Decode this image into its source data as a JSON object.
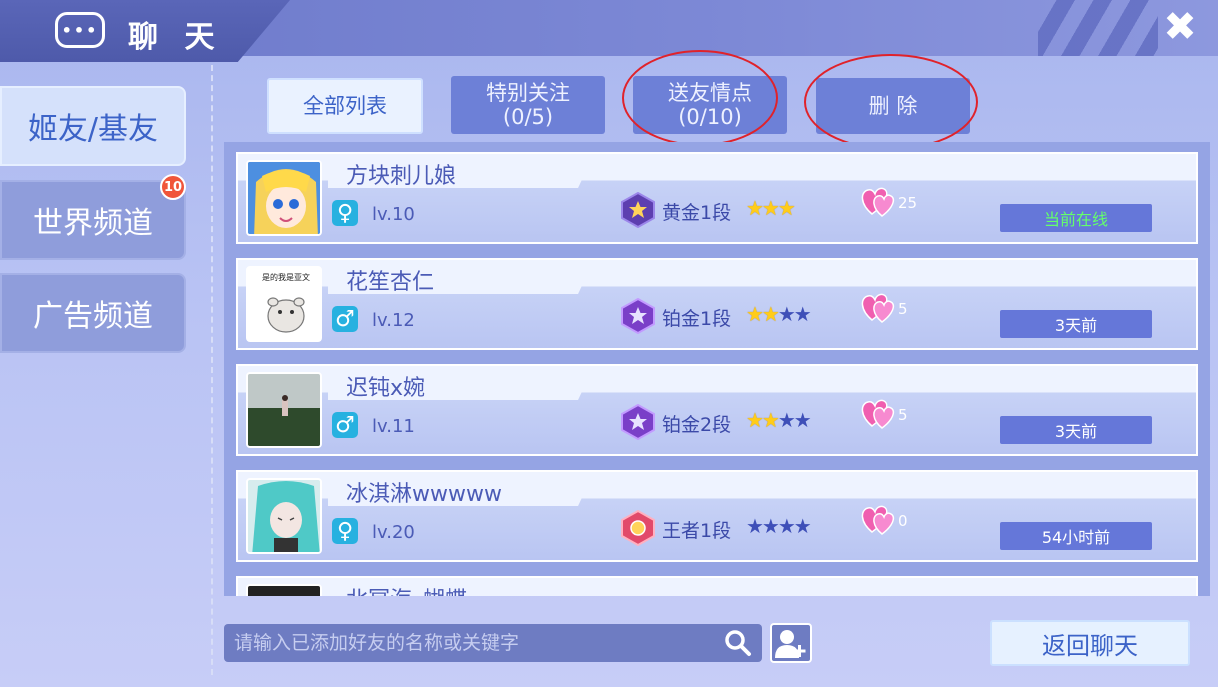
{
  "header": {
    "icon": "chat-bubble-icon",
    "icon_glyph": "•••",
    "title": "聊 天",
    "close_glyph": "✖"
  },
  "sidebar": {
    "items": [
      {
        "label": "姬友/基友",
        "active": true
      },
      {
        "label": "世界频道",
        "badge": "10"
      },
      {
        "label": "广告频道"
      }
    ]
  },
  "filters": {
    "all_list": "全部列表",
    "special_follow": {
      "label": "特别关注",
      "count": "(0/5)"
    },
    "send_points": {
      "label": "送友情点",
      "count": "(0/10)"
    },
    "delete": "删 除"
  },
  "friends": [
    {
      "name": "方块刺儿娘",
      "gender": "♀",
      "level": "lv.10",
      "rank": "黄金1段",
      "stars_on": "★★★",
      "stars_off": "",
      "hearts": "25",
      "status": "当前在线"
    },
    {
      "name": "花笙杏仁",
      "gender": "♂",
      "level": "lv.12",
      "rank": "铂金1段",
      "stars_on": "★★",
      "stars_off": "★★",
      "hearts": "5",
      "status": "3天前",
      "avatar_caption": "是的我是亚文"
    },
    {
      "name": "迟钝x婉",
      "gender": "♂",
      "level": "lv.11",
      "rank": "铂金2段",
      "stars_on": "★★",
      "stars_off": "★★",
      "hearts": "5",
      "status": "3天前"
    },
    {
      "name": "冰淇淋wwwww",
      "gender": "♀",
      "level": "lv.20",
      "rank": "王者1段",
      "stars_on": "",
      "stars_off": "★★★★",
      "hearts": "0",
      "status": "54小时前"
    },
    {
      "name": "北冥海_蝴蝶"
    }
  ],
  "search": {
    "placeholder": "请输入已添加好友的名称或关键字",
    "value": ""
  },
  "back_button": "返回聊天",
  "colors": {
    "accent": "#3c63c8",
    "online": "#64ff6b",
    "highlight_circle": "#e0222a"
  }
}
